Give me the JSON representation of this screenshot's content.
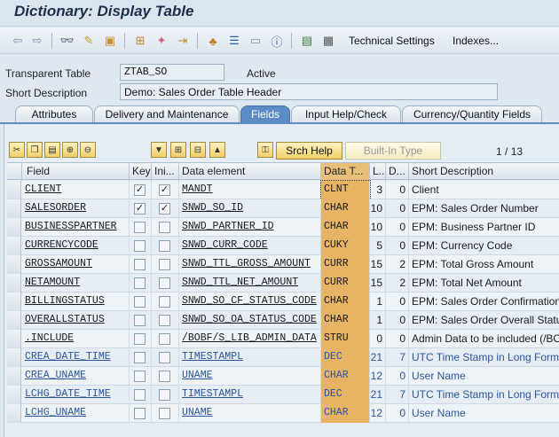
{
  "window": {
    "title": "Dictionary: Display Table"
  },
  "toolbar": {
    "icons": [
      "back-arrow-icon",
      "forward-arrow-icon",
      "glasses-icon",
      "display-change-icon",
      "activate-icon",
      "hierarchy-icon",
      "wand-icon",
      "export-icon",
      "tree-icon",
      "list-icon",
      "frame-icon",
      "info-icon",
      "graph-icon",
      "table-icon"
    ],
    "technical_settings": "Technical Settings",
    "indexes": "Indexes..."
  },
  "header": {
    "transparent_table_label": "Transparent Table",
    "table_name": "ZTAB_SO",
    "status": "Active",
    "short_desc_label": "Short Description",
    "short_desc_value": "Demo: Sales Order Table Header"
  },
  "tabs": [
    {
      "label": "Attributes"
    },
    {
      "label": "Delivery and Maintenance"
    },
    {
      "label": "Fields",
      "active": true
    },
    {
      "label": "Input Help/Check"
    },
    {
      "label": "Currency/Quantity Fields"
    }
  ],
  "fields_toolbar": {
    "srch_help": "Srch Help",
    "built_in_type": "Built-In Type",
    "page": "1",
    "page_sep": "/",
    "total": "13"
  },
  "grid": {
    "columns": [
      "Field",
      "Key",
      "Ini...",
      "Data element",
      "Data T...",
      "L...",
      "D...",
      "Short Description"
    ],
    "rows": [
      {
        "field": "CLIENT",
        "key": true,
        "ini": true,
        "element": "MANDT",
        "dtype": "CLNT",
        "len": "3",
        "dec": "0",
        "desc": "Client",
        "style": "dark"
      },
      {
        "field": "SALESORDER",
        "key": true,
        "ini": true,
        "element": "SNWD_SO_ID",
        "dtype": "CHAR",
        "len": "10",
        "dec": "0",
        "desc": "EPM: Sales Order Number",
        "style": "dark"
      },
      {
        "field": "BUSINESSPARTNER",
        "key": false,
        "ini": false,
        "element": "SNWD_PARTNER_ID",
        "dtype": "CHAR",
        "len": "10",
        "dec": "0",
        "desc": "EPM: Business Partner ID",
        "style": "dark"
      },
      {
        "field": "CURRENCYCODE",
        "key": false,
        "ini": false,
        "element": "SNWD_CURR_CODE",
        "dtype": "CUKY",
        "len": "5",
        "dec": "0",
        "desc": "EPM: Currency Code",
        "style": "dark"
      },
      {
        "field": "GROSSAMOUNT",
        "key": false,
        "ini": false,
        "element": "SNWD_TTL_GROSS_AMOUNT",
        "dtype": "CURR",
        "len": "15",
        "dec": "2",
        "desc": "EPM: Total Gross Amount",
        "style": "dark"
      },
      {
        "field": "NETAMOUNT",
        "key": false,
        "ini": false,
        "element": "SNWD_TTL_NET_AMOUNT",
        "dtype": "CURR",
        "len": "15",
        "dec": "2",
        "desc": "EPM: Total Net Amount",
        "style": "dark"
      },
      {
        "field": "BILLINGSTATUS",
        "key": false,
        "ini": false,
        "element": "SNWD_SO_CF_STATUS_CODE",
        "dtype": "CHAR",
        "len": "1",
        "dec": "0",
        "desc": "EPM: Sales Order Confirmation",
        "style": "dark"
      },
      {
        "field": "OVERALLSTATUS",
        "key": false,
        "ini": false,
        "element": "SNWD_SO_OA_STATUS_CODE",
        "dtype": "CHAR",
        "len": "1",
        "dec": "0",
        "desc": "EPM: Sales Order Overall Status",
        "style": "dark"
      },
      {
        "field": ".INCLUDE",
        "key": false,
        "ini": false,
        "element": "/BOBF/S_LIB_ADMIN_DATA",
        "dtype": "STRU",
        "len": "0",
        "dec": "0",
        "desc": "Admin Data to be included (/BOBF",
        "style": "dark"
      },
      {
        "field": "CREA_DATE_TIME",
        "key": false,
        "ini": false,
        "element": "TIMESTAMPL",
        "dtype": "DEC",
        "len": "21",
        "dec": "7",
        "desc": "UTC Time Stamp in Long Form",
        "style": "blue"
      },
      {
        "field": "CREA_UNAME",
        "key": false,
        "ini": false,
        "element": "UNAME",
        "dtype": "CHAR",
        "len": "12",
        "dec": "0",
        "desc": "User Name",
        "style": "blue"
      },
      {
        "field": "LCHG_DATE_TIME",
        "key": false,
        "ini": false,
        "element": "TIMESTAMPL",
        "dtype": "DEC",
        "len": "21",
        "dec": "7",
        "desc": "UTC Time Stamp in Long Form",
        "style": "blue"
      },
      {
        "field": "LCHG_UNAME",
        "key": false,
        "ini": false,
        "element": "UNAME",
        "dtype": "CHAR",
        "len": "12",
        "dec": "0",
        "desc": "User Name",
        "style": "blue"
      }
    ]
  }
}
